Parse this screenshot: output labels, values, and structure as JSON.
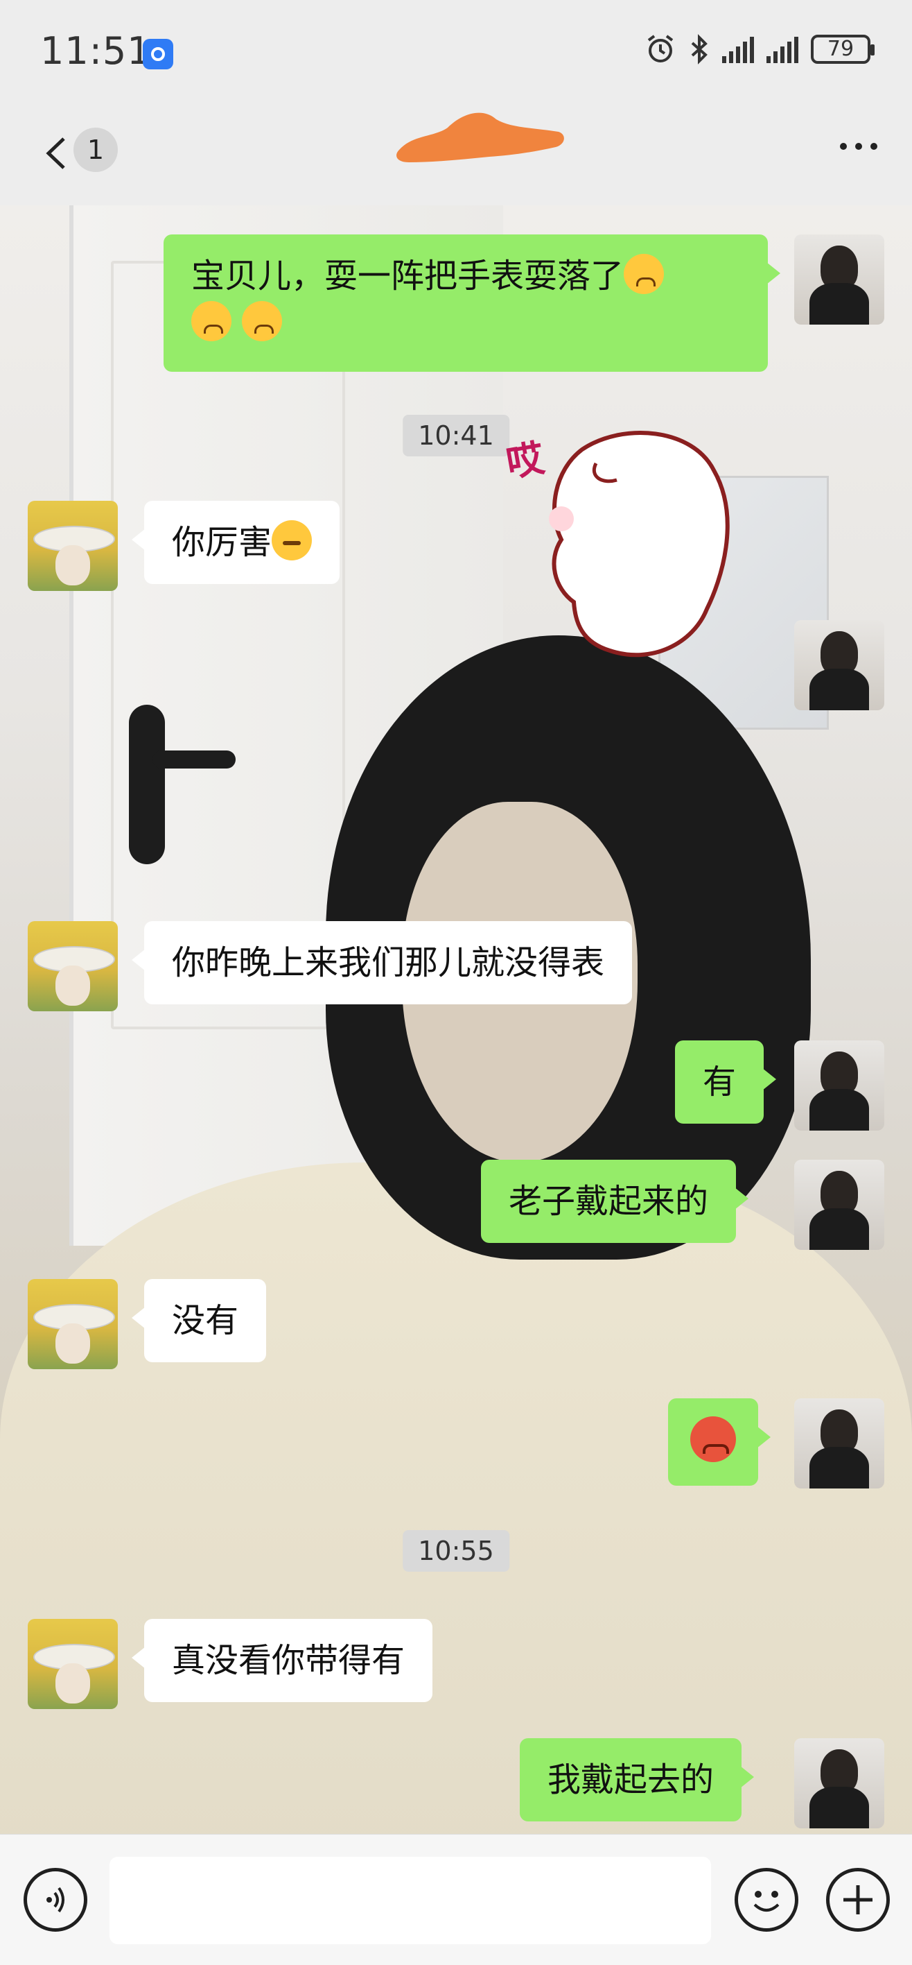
{
  "status_bar": {
    "time": "11:51",
    "battery": "79"
  },
  "nav": {
    "unread_count": "1"
  },
  "messages": {
    "m1": {
      "text": "宝贝儿，耍一阵把手表耍落了",
      "line2_emojis": ""
    },
    "t1": "10:41",
    "m2": {
      "text": "你厉害"
    },
    "m3": {
      "sticker_text": "哎"
    },
    "m4": {
      "text": "你昨晚上来我们那儿就没得表"
    },
    "m5": {
      "text": "有"
    },
    "m6": {
      "text": "老子戴起来的"
    },
    "m7": {
      "text": "没有"
    },
    "t2": "10:55",
    "m8": {
      "text": "真没看你带得有"
    },
    "m9": {
      "text": "我戴起去的"
    }
  },
  "colors": {
    "my_bubble": "#95ec69",
    "their_bubble": "#ffffff",
    "chrome": "#ededed"
  },
  "icons": [
    "back-chevron-icon",
    "more-icon",
    "voice-icon",
    "emoji-icon",
    "plus-icon",
    "alarm-icon",
    "bluetooth-icon",
    "signal-icon",
    "battery-icon"
  ]
}
